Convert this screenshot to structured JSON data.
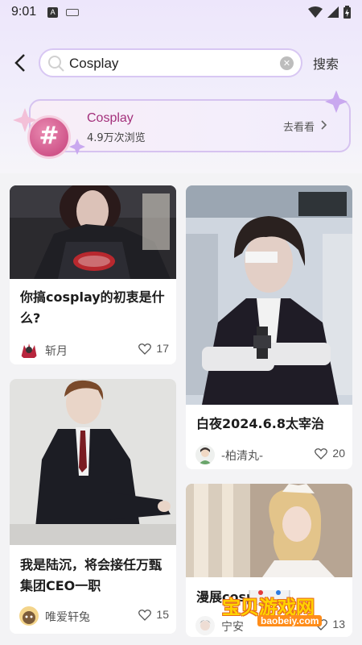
{
  "status_bar": {
    "time": "9:01",
    "notification_icon_letter": "A"
  },
  "search": {
    "query": "Cosplay",
    "submit_label": "搜索"
  },
  "topic": {
    "symbol": "#",
    "title": "Cosplay",
    "views": "4.9万次浏览",
    "go_label": "去看看"
  },
  "posts": [
    {
      "title": "你搞cosplay的初衷是什么?",
      "author": "斩月",
      "likes": "17"
    },
    {
      "title": "白夜2024.6.8太宰治",
      "author": "-柏清丸-",
      "likes": "20"
    },
    {
      "title": "我是陆沉，将会接任万甄集团CEO一职",
      "author": "唯爱轩兔",
      "likes": "15"
    },
    {
      "title": "漫展cosplay",
      "author": "宁安",
      "likes": "13"
    }
  ],
  "watermark": {
    "text": "宝贝游戏网",
    "url": "baobeiy.com"
  },
  "colors": {
    "accent_purple": "#d8c7f3",
    "topic_pink": "#a3307b",
    "background": "#f3f3f5"
  }
}
